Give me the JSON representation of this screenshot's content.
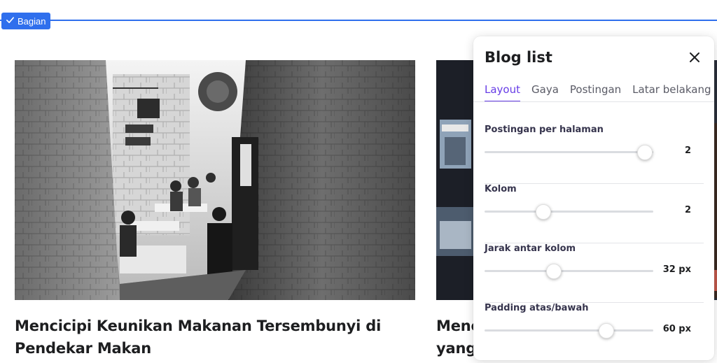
{
  "section": {
    "badge_label": "Bagian",
    "accent": "#2f6fed"
  },
  "posts": [
    {
      "title": "Mencicipi Keunikan Makanan Tersembunyi di Pendekar Makan"
    },
    {
      "title_line1": "Mene",
      "title_line2": "yang"
    }
  ],
  "panel": {
    "title": "Blog list",
    "tabs": [
      {
        "label": "Layout",
        "active": true
      },
      {
        "label": "Gaya",
        "active": false
      },
      {
        "label": "Postingan",
        "active": false
      },
      {
        "label": "Latar belakang",
        "active": false
      }
    ],
    "settings": [
      {
        "label": "Postingan per halaman",
        "value": "2",
        "level": 0.95
      },
      {
        "label": "Kolom",
        "value": "2",
        "level": 0.35
      },
      {
        "label": "Jarak antar kolom",
        "value": "32 px",
        "level": 0.41
      },
      {
        "label": "Padding atas/bawah",
        "value": "60 px",
        "level": 0.72
      }
    ],
    "accent": "#673de6"
  }
}
